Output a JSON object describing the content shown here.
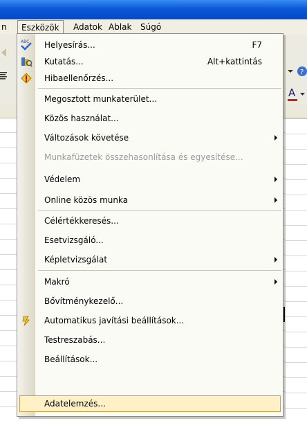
{
  "menubar": {
    "partial_left": "n",
    "items": [
      "Eszközök",
      "Adatok",
      "Ablak",
      "Súgó"
    ]
  },
  "menu": {
    "items": [
      {
        "label": "Helyesírás...",
        "shortcut": "F7"
      },
      {
        "label": "Kutatás...",
        "shortcut": "Alt+kattintás"
      },
      {
        "label": "Hibaellenőrzés..."
      },
      {
        "label": "Megosztott munkaterület..."
      },
      {
        "label": "Közös használat..."
      },
      {
        "label": "Változások követése"
      },
      {
        "label": "Munkafüzetek összehasonlítása és egyesítése..."
      },
      {
        "label": "Védelem"
      },
      {
        "label": "Online közös munka"
      },
      {
        "label": "Célértékkeresés..."
      },
      {
        "label": "Esetvizsgáló..."
      },
      {
        "label": "Képletvizsgálat"
      },
      {
        "label": "Makró"
      },
      {
        "label": "Bővítménykezelő..."
      },
      {
        "label": "Automatikus javítási beállítások..."
      },
      {
        "label": "Testreszabás..."
      },
      {
        "label": "Beállítások..."
      },
      {
        "label": "Adatelemzés..."
      }
    ]
  },
  "toolbar": {
    "font_color_letter": "A"
  },
  "colors": {
    "highlight_bg": "#fff0c6",
    "highlight_border": "#c9a244",
    "disabled_text": "#9c9c9c"
  }
}
